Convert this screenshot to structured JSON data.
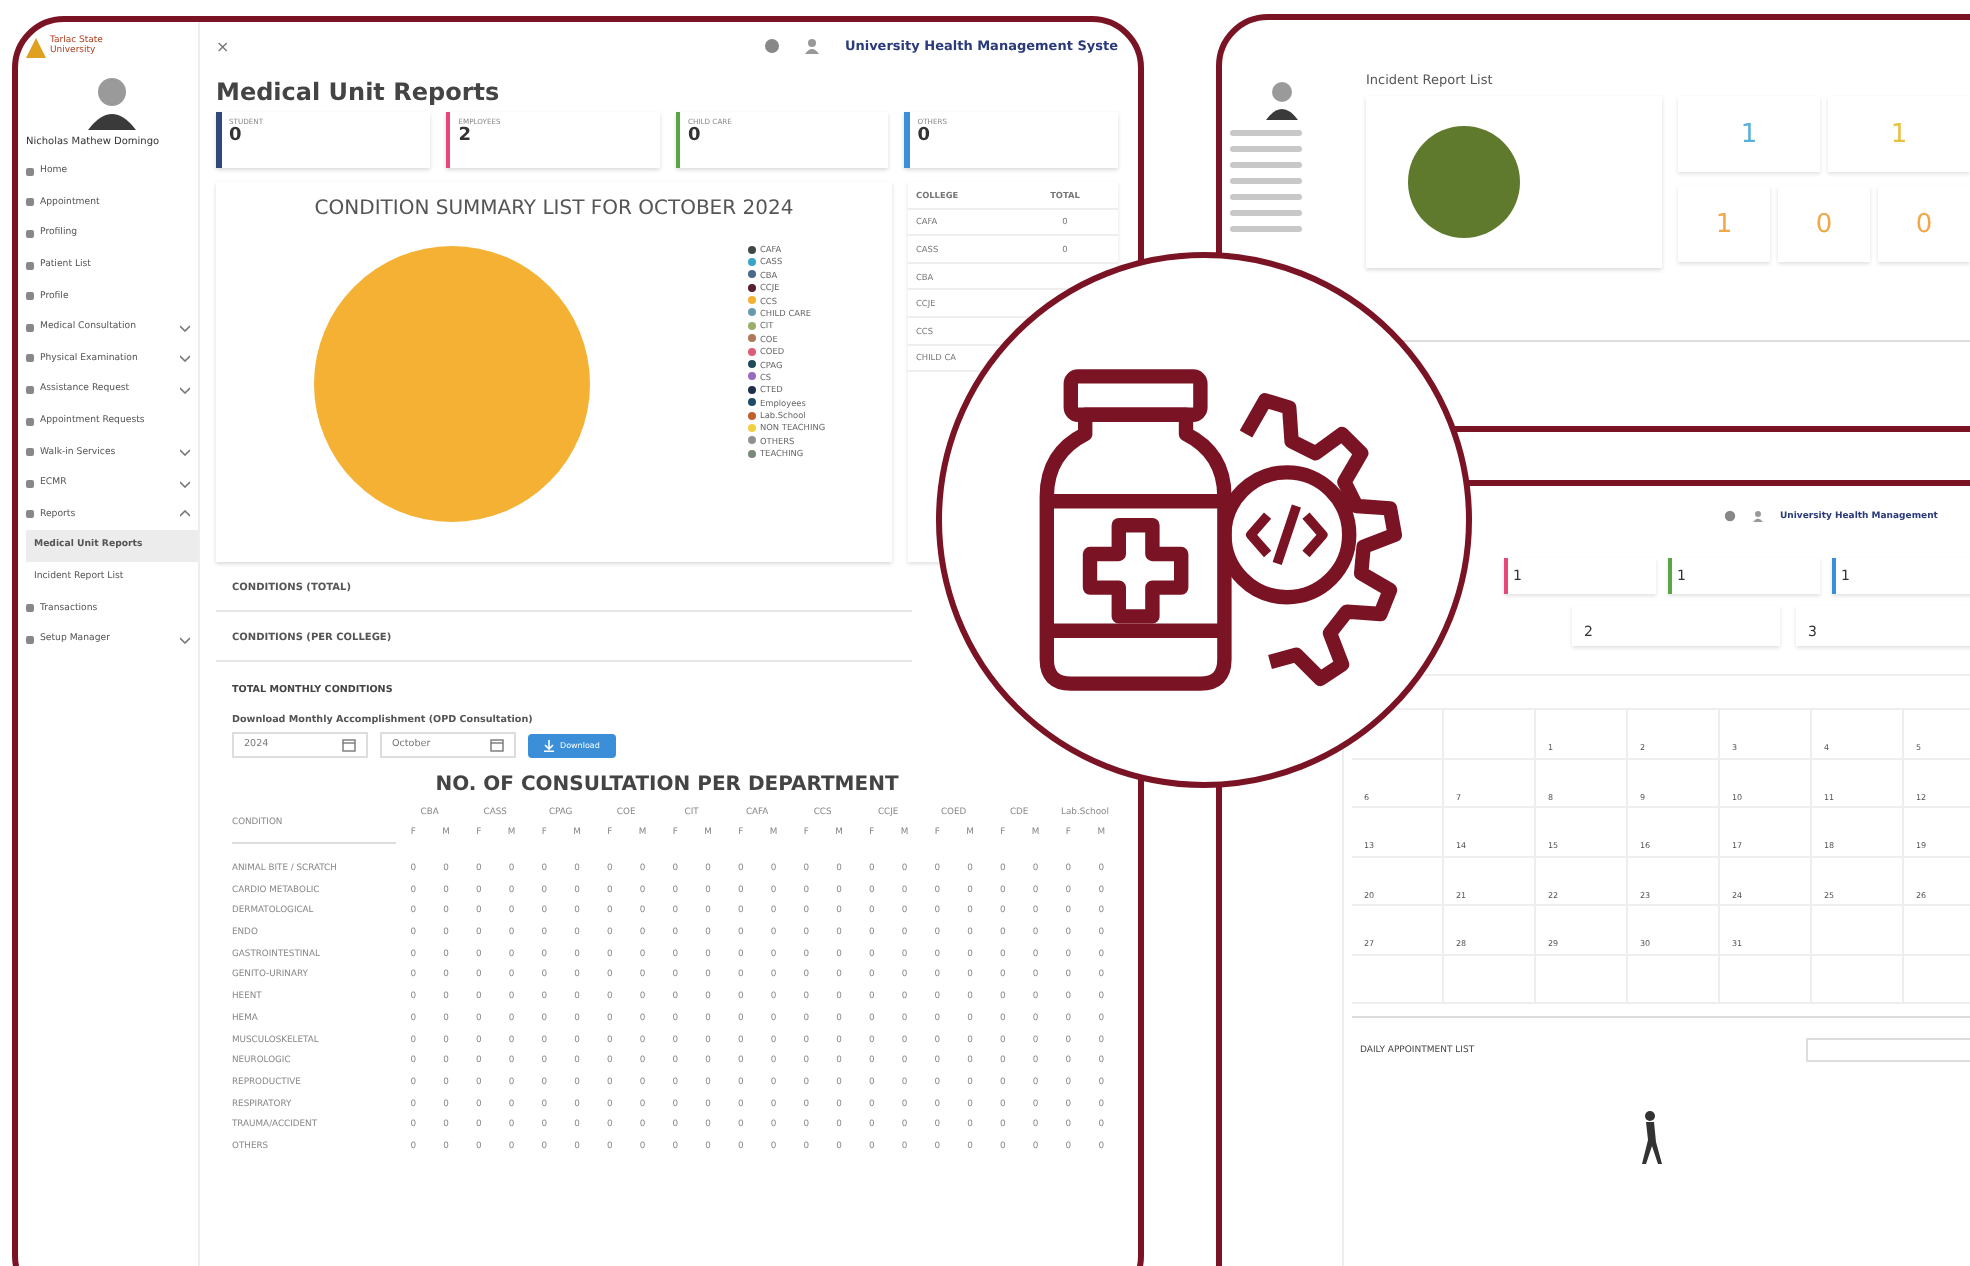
{
  "main_window": {
    "logo_text": "Tarlac State University",
    "user_name": "Nicholas Mathew Domingo",
    "sidebar": [
      {
        "kind": "link",
        "label": "Home",
        "selected": false
      },
      {
        "kind": "link",
        "label": "Appointment",
        "selected": false
      },
      {
        "kind": "link",
        "label": "Profiling",
        "selected": false
      },
      {
        "kind": "link",
        "label": "Patient List",
        "selected": false
      },
      {
        "kind": "link",
        "label": "Profile",
        "selected": false
      },
      {
        "kind": "group",
        "label": "Medical Consultation",
        "selected": false,
        "expanded": false
      },
      {
        "kind": "group",
        "label": "Physical Examination",
        "selected": false,
        "expanded": false
      },
      {
        "kind": "group",
        "label": "Assistance Request",
        "selected": false,
        "expanded": false
      },
      {
        "kind": "link",
        "label": "Appointment Requests",
        "selected": false
      },
      {
        "kind": "group",
        "label": "Walk-in Services",
        "selected": false,
        "expanded": false
      },
      {
        "kind": "group",
        "label": "ECMR",
        "selected": false,
        "expanded": false
      },
      {
        "kind": "group",
        "label": "Reports",
        "selected": false,
        "expanded": true,
        "children": [
          {
            "label": "Medical Unit Reports",
            "selected": true
          },
          {
            "label": "Incident Report List",
            "selected": false
          }
        ]
      },
      {
        "kind": "link",
        "label": "Transactions",
        "selected": false
      },
      {
        "kind": "group",
        "label": "Setup Manager",
        "selected": false,
        "expanded": false
      }
    ],
    "close_icon": "×",
    "app_title": "University Health Management Syste",
    "page_title": "Medical Unit Reports",
    "stat_cards": [
      {
        "label": "STUDENT",
        "value": "0",
        "color": "#2f4a7a"
      },
      {
        "label": "EMPLOYEES",
        "value": "2",
        "color": "#e8477a"
      },
      {
        "label": "CHILD CARE",
        "value": "0",
        "color": "#5aa646"
      },
      {
        "label": "OTHERS",
        "value": "0",
        "color": "#3b8fd6"
      }
    ],
    "summary_chart": {
      "title": "CONDITION SUMMARY LIST FOR OCTOBER 2024",
      "legend": [
        {
          "label": "CAFA",
          "color": "#3f4a44"
        },
        {
          "label": "CASS",
          "color": "#37a4c9"
        },
        {
          "label": "CBA",
          "color": "#4a6a8a"
        },
        {
          "label": "CCJE",
          "color": "#5a2030"
        },
        {
          "label": "CCS",
          "color": "#f5b133"
        },
        {
          "label": "CHILD CARE",
          "color": "#6a9ab0"
        },
        {
          "label": "CIT",
          "color": "#9ab06a"
        },
        {
          "label": "COE",
          "color": "#b07a5a"
        },
        {
          "label": "COED",
          "color": "#e05a7a"
        },
        {
          "label": "CPAG",
          "color": "#1f4a5a"
        },
        {
          "label": "CS",
          "color": "#9a6ac0"
        },
        {
          "label": "CTED",
          "color": "#1f2f4a"
        },
        {
          "label": "Employees",
          "color": "#1f4a6a"
        },
        {
          "label": "Lab.School",
          "color": "#c0602a"
        },
        {
          "label": "NON TEACHING",
          "color": "#f0d040"
        },
        {
          "label": "OTHERS",
          "color": "#909090"
        },
        {
          "label": "TEACHING",
          "color": "#7a8a7a"
        }
      ]
    },
    "college_table": {
      "columns": [
        "COLLEGE",
        "TOTAL"
      ],
      "rows": [
        {
          "college": "CAFA",
          "total": "0"
        },
        {
          "college": "CASS",
          "total": "0"
        },
        {
          "college": "CBA"
        },
        {
          "college": "CCJE"
        },
        {
          "college": "CCS"
        },
        {
          "college": "CHILD CA"
        }
      ]
    },
    "accordions": [
      "CONDITIONS (TOTAL)",
      "CONDITIONS (PER COLLEGE)"
    ],
    "monthly": {
      "heading": "TOTAL MONTHLY CONDITIONS",
      "download_label": "Download Monthly Accomplishment (OPD Consultation)",
      "year": "2024",
      "month": "October",
      "button": "Download"
    },
    "consultation_table": {
      "title": "NO. OF CONSULTATION PER DEPARTMENT",
      "condition_header": "CONDITION",
      "departments": [
        {
          "label": "CBA",
          "sexes": [
            "F",
            "M"
          ]
        },
        {
          "label": "CASS",
          "sexes": [
            "F",
            "M"
          ]
        },
        {
          "label": "CPAG",
          "sexes": [
            "F",
            "M"
          ]
        },
        {
          "label": "COE",
          "sexes": [
            "F",
            "M"
          ]
        },
        {
          "label": "CIT",
          "sexes": [
            "F",
            "M"
          ]
        },
        {
          "label": "CAFA",
          "sexes": [
            "F",
            "M"
          ]
        },
        {
          "label": "CCS",
          "sexes": [
            "F",
            "M"
          ]
        },
        {
          "label": "CCJE",
          "sexes": [
            "F",
            "M"
          ]
        },
        {
          "label": "COED",
          "sexes": [
            "F",
            "M"
          ]
        },
        {
          "label": "CDE",
          "sexes": [
            "F",
            "M"
          ]
        },
        {
          "label": "Lab.School",
          "sexes": [
            "F",
            "M"
          ]
        }
      ],
      "rows": [
        {
          "condition": "ANIMAL BITE / SCRATCH",
          "cells": [
            "0",
            "0",
            "0",
            "0",
            "0",
            "0",
            "0",
            "0",
            "0",
            "0",
            "0",
            "0",
            "0",
            "0",
            "0",
            "0",
            "0",
            "0",
            "0",
            "0",
            "0",
            "0"
          ]
        },
        {
          "condition": "CARDIO METABOLIC",
          "cells": [
            "0",
            "0",
            "0",
            "0",
            "0",
            "0",
            "0",
            "0",
            "0",
            "0",
            "0",
            "0",
            "0",
            "0",
            "0",
            "0",
            "0",
            "0",
            "0",
            "0",
            "0",
            "0"
          ]
        },
        {
          "condition": "DERMATOLOGICAL",
          "cells": [
            "0",
            "0",
            "0",
            "0",
            "0",
            "0",
            "0",
            "0",
            "0",
            "0",
            "0",
            "0",
            "0",
            "0",
            "0",
            "0",
            "0",
            "0",
            "0",
            "0",
            "0",
            "0"
          ]
        },
        {
          "condition": "ENDO",
          "cells": [
            "0",
            "0",
            "0",
            "0",
            "0",
            "0",
            "0",
            "0",
            "0",
            "0",
            "0",
            "0",
            "0",
            "0",
            "0",
            "0",
            "0",
            "0",
            "0",
            "0",
            "0",
            "0"
          ]
        },
        {
          "condition": "GASTROINTESTINAL",
          "cells": [
            "0",
            "0",
            "0",
            "0",
            "0",
            "0",
            "0",
            "0",
            "0",
            "0",
            "0",
            "0",
            "0",
            "0",
            "0",
            "0",
            "0",
            "0",
            "0",
            "0",
            "0",
            "0"
          ]
        },
        {
          "condition": "GENITO-URINARY",
          "cells": [
            "0",
            "0",
            "0",
            "0",
            "0",
            "0",
            "0",
            "0",
            "0",
            "0",
            "0",
            "0",
            "0",
            "0",
            "0",
            "0",
            "0",
            "0",
            "0",
            "0",
            "0",
            "0"
          ]
        },
        {
          "condition": "HEENT",
          "cells": [
            "0",
            "0",
            "0",
            "0",
            "0",
            "0",
            "0",
            "0",
            "0",
            "0",
            "0",
            "0",
            "0",
            "0",
            "0",
            "0",
            "0",
            "0",
            "0",
            "0",
            "0",
            "0"
          ]
        },
        {
          "condition": "HEMA",
          "cells": [
            "0",
            "0",
            "0",
            "0",
            "0",
            "0",
            "0",
            "0",
            "0",
            "0",
            "0",
            "0",
            "0",
            "0",
            "0",
            "0",
            "0",
            "0",
            "0",
            "0",
            "0",
            "0"
          ]
        },
        {
          "condition": "MUSCULOSKELETAL",
          "cells": [
            "0",
            "0",
            "0",
            "0",
            "0",
            "0",
            "0",
            "0",
            "0",
            "0",
            "0",
            "0",
            "0",
            "0",
            "0",
            "0",
            "0",
            "0",
            "0",
            "0",
            "0",
            "0"
          ]
        },
        {
          "condition": "NEUROLOGIC",
          "cells": [
            "0",
            "0",
            "0",
            "0",
            "0",
            "0",
            "0",
            "0",
            "0",
            "0",
            "0",
            "0",
            "0",
            "0",
            "0",
            "0",
            "0",
            "0",
            "0",
            "0",
            "0",
            "0"
          ]
        },
        {
          "condition": "REPRODUCTIVE",
          "cells": [
            "0",
            "0",
            "0",
            "0",
            "0",
            "0",
            "0",
            "0",
            "0",
            "0",
            "0",
            "0",
            "0",
            "0",
            "0",
            "0",
            "0",
            "0",
            "0",
            "0",
            "0",
            "0"
          ]
        },
        {
          "condition": "RESPIRATORY",
          "cells": [
            "0",
            "0",
            "0",
            "0",
            "0",
            "0",
            "0",
            "0",
            "0",
            "0",
            "0",
            "0",
            "0",
            "0",
            "0",
            "0",
            "0",
            "0",
            "0",
            "0",
            "0",
            "0"
          ]
        },
        {
          "condition": "TRAUMA/ACCIDENT",
          "cells": [
            "0",
            "0",
            "0",
            "0",
            "0",
            "0",
            "0",
            "0",
            "0",
            "0",
            "0",
            "0",
            "0",
            "0",
            "0",
            "0",
            "0",
            "0",
            "0",
            "0",
            "0",
            "0"
          ]
        },
        {
          "condition": "OTHERS",
          "cells": [
            "0",
            "0",
            "0",
            "0",
            "0",
            "0",
            "0",
            "0",
            "0",
            "0",
            "0",
            "0",
            "0",
            "0",
            "0",
            "0",
            "0",
            "0",
            "0",
            "0",
            "0",
            "0"
          ]
        }
      ]
    }
  },
  "incident_window": {
    "page_title": "Incident Report List",
    "counters": [
      {
        "value": "1",
        "color": "#5ab0d8"
      },
      {
        "value": "1",
        "color": "#e8c040"
      },
      {
        "value": "1",
        "color": "#f0a848"
      },
      {
        "value": "0",
        "color": "#f0a848"
      },
      {
        "value": "0",
        "color": "#f0a848"
      }
    ]
  },
  "calendar_window": {
    "app_title": "University Health Management",
    "stat_cards": [
      {
        "value": "1",
        "color": "#e8477a"
      },
      {
        "value": "1",
        "color": "#5aa646"
      },
      {
        "value": "1",
        "color": "#3b8fd6"
      }
    ],
    "stat_cards_2": [
      {
        "value": "2"
      },
      {
        "value": "3"
      }
    ],
    "weeks": [
      {
        "kind": "first",
        "days": [
          "1",
          "2",
          "3",
          "4",
          "5"
        ]
      },
      {
        "kind": "full",
        "days": [
          "6",
          "7",
          "8",
          "9",
          "10",
          "11",
          "12"
        ]
      },
      {
        "kind": "full",
        "days": [
          "13",
          "14",
          "15",
          "16",
          "17",
          "18",
          "19"
        ]
      },
      {
        "kind": "full",
        "days": [
          "20",
          "21",
          "22",
          "23",
          "24",
          "25",
          "26"
        ]
      },
      {
        "kind": "last",
        "days": [
          "27",
          "28",
          "29",
          "30",
          "31"
        ]
      }
    ],
    "list_title": "DAILY APPOINTMENT LIST"
  }
}
